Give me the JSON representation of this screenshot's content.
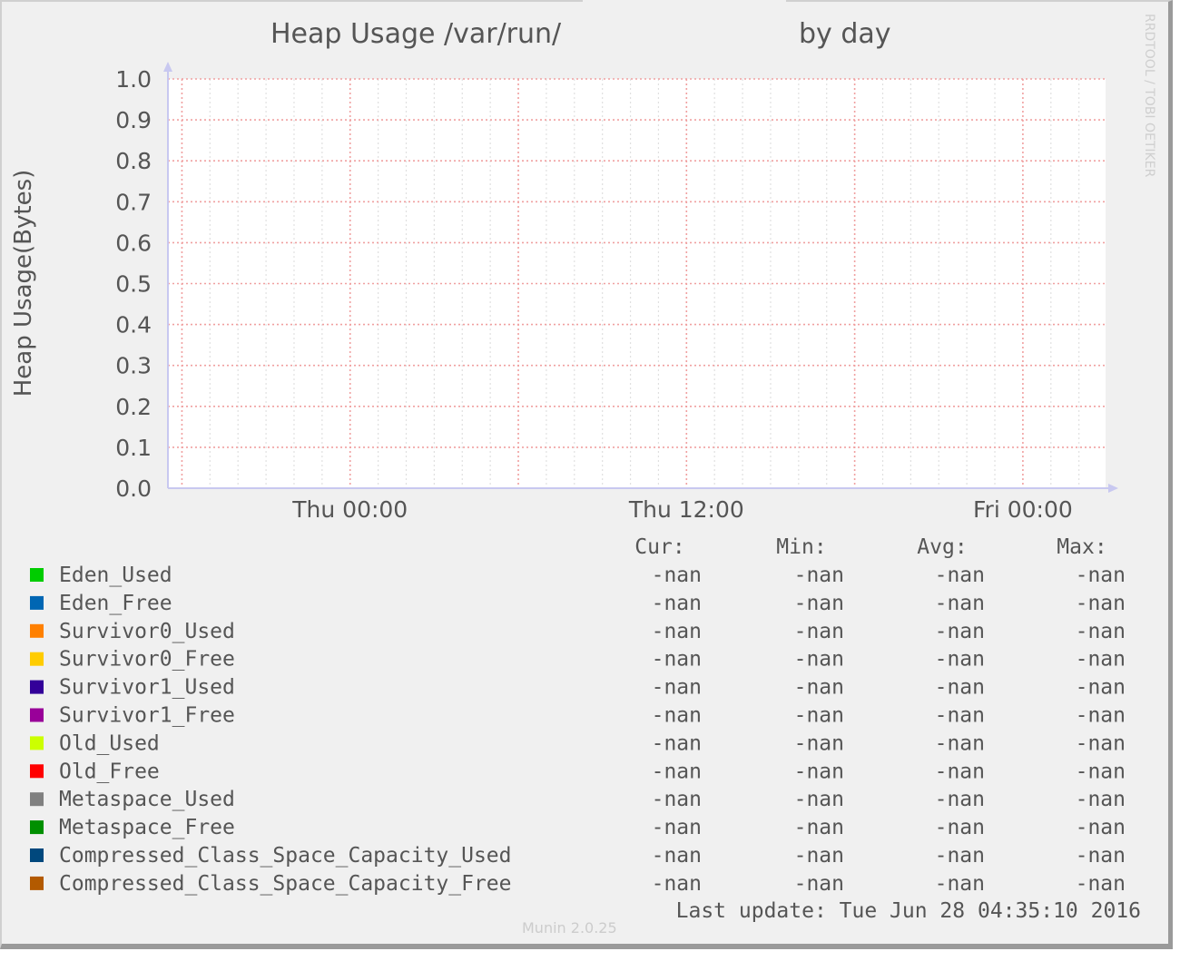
{
  "chart_data": {
    "type": "line",
    "title": "Heap Usage /var/run/",
    "title_suffix": "by day",
    "ylabel": "Heap Usage(Bytes)",
    "xlabel": "",
    "ylim": [
      0,
      1.0
    ],
    "yticks": [
      "0.0",
      "0.1",
      "0.2",
      "0.3",
      "0.4",
      "0.5",
      "0.6",
      "0.7",
      "0.8",
      "0.9",
      "1.0"
    ],
    "xlim_hours_rel_thu_0000": [
      -6.5,
      26.95
    ],
    "xticks": [
      {
        "label": "Thu 00:00",
        "hour": 0
      },
      {
        "label": "Thu 12:00",
        "hour": 12
      },
      {
        "label": "Fri 00:00",
        "hour": 24
      }
    ],
    "grid": true,
    "watermark": "RRDTOOL / TOBI OETIKER",
    "legend_headers": [
      "Cur:",
      "Min:",
      "Avg:",
      "Max:"
    ],
    "series": [
      {
        "name": "Eden_Used",
        "color": "#00cc00",
        "cur": "-nan",
        "min": "-nan",
        "avg": "-nan",
        "max": "-nan"
      },
      {
        "name": "Eden_Free",
        "color": "#0066b3",
        "cur": "-nan",
        "min": "-nan",
        "avg": "-nan",
        "max": "-nan"
      },
      {
        "name": "Survivor0_Used",
        "color": "#ff8000",
        "cur": "-nan",
        "min": "-nan",
        "avg": "-nan",
        "max": "-nan"
      },
      {
        "name": "Survivor0_Free",
        "color": "#ffcc00",
        "cur": "-nan",
        "min": "-nan",
        "avg": "-nan",
        "max": "-nan"
      },
      {
        "name": "Survivor1_Used",
        "color": "#330099",
        "cur": "-nan",
        "min": "-nan",
        "avg": "-nan",
        "max": "-nan"
      },
      {
        "name": "Survivor1_Free",
        "color": "#990099",
        "cur": "-nan",
        "min": "-nan",
        "avg": "-nan",
        "max": "-nan"
      },
      {
        "name": "Old_Used",
        "color": "#ccff00",
        "cur": "-nan",
        "min": "-nan",
        "avg": "-nan",
        "max": "-nan"
      },
      {
        "name": "Old_Free",
        "color": "#ff0000",
        "cur": "-nan",
        "min": "-nan",
        "avg": "-nan",
        "max": "-nan"
      },
      {
        "name": "Metaspace_Used",
        "color": "#808080",
        "cur": "-nan",
        "min": "-nan",
        "avg": "-nan",
        "max": "-nan"
      },
      {
        "name": "Metaspace_Free",
        "color": "#008f00",
        "cur": "-nan",
        "min": "-nan",
        "avg": "-nan",
        "max": "-nan"
      },
      {
        "name": "Compressed_Class_Space_Capacity_Used",
        "color": "#00487d",
        "cur": "-nan",
        "min": "-nan",
        "avg": "-nan",
        "max": "-nan"
      },
      {
        "name": "Compressed_Class_Space_Capacity_Free",
        "color": "#b35a00",
        "cur": "-nan",
        "min": "-nan",
        "avg": "-nan",
        "max": "-nan"
      }
    ],
    "last_update": "Last update: Tue Jun 28 04:35:10 2016",
    "footer": "Munin 2.0.25"
  }
}
